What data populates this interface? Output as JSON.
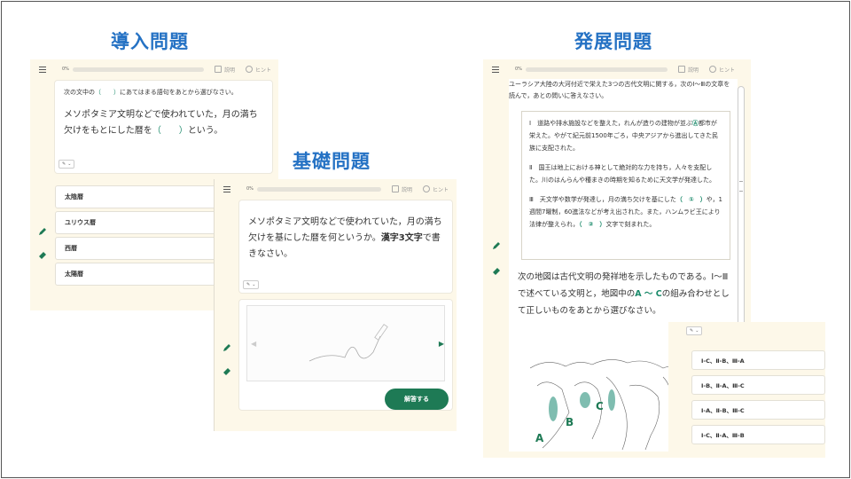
{
  "headings": {
    "intro": "導入問題",
    "basic": "基礎問題",
    "advanced": "発展問題"
  },
  "topbar": {
    "percent": "0%",
    "explain": "説明",
    "hint": "ヒント"
  },
  "intro": {
    "instruction_a": "次の文中の",
    "instruction_paren": "（　　）",
    "instruction_b": "にあてはまる語句をあとから選びなさい。",
    "question_a": "メソポタミア文明などで使われていた，月の満ち欠けをもとにした暦を",
    "question_paren": "（　　）",
    "question_b": "という。",
    "choices": [
      "太陰暦",
      "ユリウス暦",
      "西暦",
      "太陽暦"
    ]
  },
  "basic": {
    "question_a": "メソポタミア文明などで使われていた，月の満ち欠けを基にした暦を何というか。",
    "question_bold": "漢字3文字",
    "question_b": "で書きなさい。",
    "answer_button": "解答する"
  },
  "advanced": {
    "instruction": "ユーラシア大陸の大河付近で栄えた3つの古代文明に関する，次のⅠ～Ⅲの文章を読んで，あとの問いに答えなさい。",
    "passage1_a": "Ⅰ　道路や排水施設などを整えた，れんが造りの建物が並ぶ",
    "passage1_circ": "Ⓐ",
    "passage1_b": "都市が栄えた。やがて紀元前1500年ごろ，中央アジアから進出してきた民族に支配された。",
    "passage2": "Ⅱ　国王は地上における神として絶対的な力を持ち，人々を支配した。川のはんらんや種まきの時期を知るために天文学が発達した。",
    "passage3_a": "Ⅲ　天文学や数学が発達し，月の満ち欠けを基にした",
    "passage3_p1": "（　①　）",
    "passage3_b": "や，1週間7曜制，60進法などが考え出された。また，ハンムラビ王により法律が整えられ，",
    "passage3_p2": "（　②　）",
    "passage3_c": "文字で刻まれた。",
    "question_a": "次の地図は古代文明の発祥地を示したものである。Ⅰ～Ⅲで述べている文明と，地図中の",
    "question_abc": "A ～ C",
    "question_b": "の組み合わせとして正しいものをあとから選びなさい。",
    "map_labels": [
      "A",
      "B",
      "C"
    ],
    "choices": [
      "Ⅰ-C、Ⅱ-B、Ⅲ-A",
      "Ⅰ-B、Ⅱ-A、Ⅲ-C",
      "Ⅰ-A、Ⅱ-B、Ⅲ-C",
      "Ⅰ-C、Ⅱ-A、Ⅲ-B"
    ]
  },
  "colors": {
    "heading": "#2572c4",
    "accent_green": "#1e7a55",
    "panel_bg": "#fdf8e9"
  }
}
